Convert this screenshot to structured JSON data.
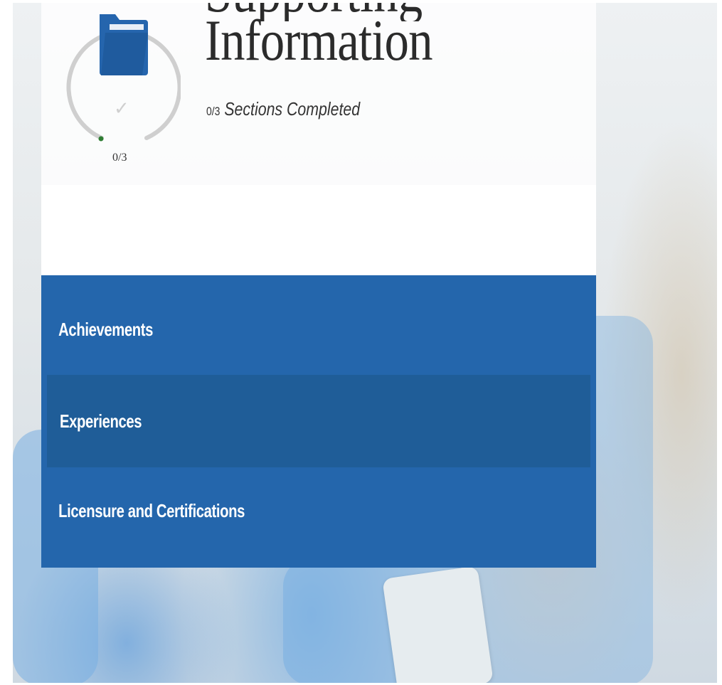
{
  "header": {
    "title": "Information",
    "title_partial_line": "Supporting",
    "sections_completed_count": "0/3",
    "sections_completed_label": "Sections Completed",
    "progress_label": "0/3",
    "progress_value": 0
  },
  "icons": {
    "folder": "folder-icon",
    "check": "checkmark-icon"
  },
  "menu": {
    "items": [
      {
        "label": "Achievements",
        "active": false
      },
      {
        "label": "Experiences",
        "active": true
      },
      {
        "label": "Licensure and Certifications",
        "active": false
      }
    ]
  },
  "colors": {
    "menu_background": "#2466ac",
    "menu_active": "#1f5d98",
    "folder_blue": "#2565ad",
    "progress_green": "#2e7d32",
    "ring_gray": "#cfcfcf"
  }
}
